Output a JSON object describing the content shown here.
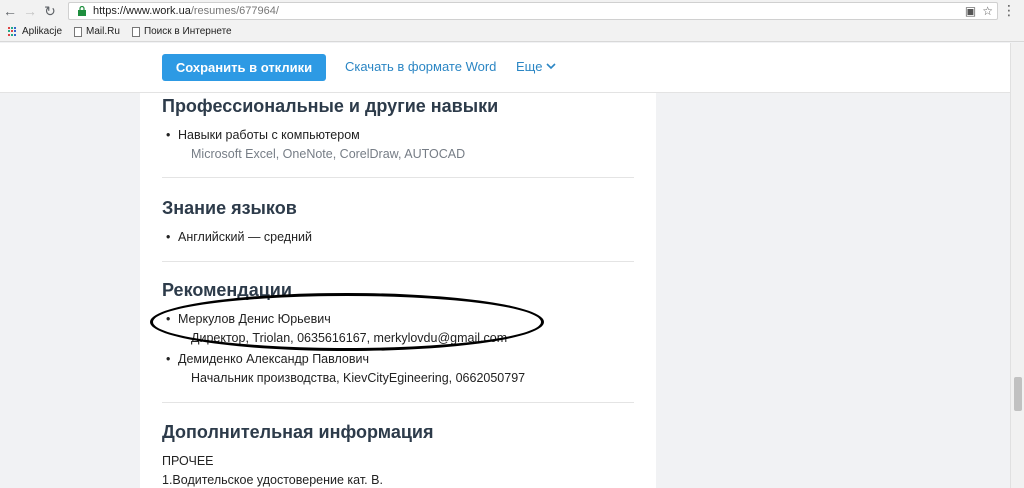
{
  "browser": {
    "url_host": "https://www.work.ua",
    "url_path": "/resumes/677964/",
    "bookmarks": [
      {
        "label": "Aplikacje",
        "icon": "apps-icon"
      },
      {
        "label": "Mail.Ru",
        "icon": "page-icon"
      },
      {
        "label": "Поиск в Интернете",
        "icon": "page-icon"
      }
    ]
  },
  "toolbar": {
    "save_label": "Сохранить в отклики",
    "word_label": "Скачать в формате Word",
    "more_label": "Еще"
  },
  "skills": {
    "title": "Профессиональные и другие навыки",
    "item": "Навыки работы с компьютером",
    "detail": "Microsoft Excel, OneNote, CorelDraw, AUTOCAD"
  },
  "languages": {
    "title": "Знание языков",
    "item": "Английский — средний"
  },
  "recommendations": {
    "title": "Рекомендации",
    "items": [
      {
        "name": "Меркулов Денис Юрьевич",
        "detail": "Директор, Triolan, 0635616167, merkylovdu@gmail.com"
      },
      {
        "name": "Демиденко Александр Павлович",
        "detail": "Начальник производства, KievCityEgineering, 0662050797"
      }
    ]
  },
  "additional": {
    "title": "Дополнительная информация",
    "line1": "ПРОЧЕЕ",
    "line2": "1.Водительское удостоверение кат. В."
  },
  "colors": {
    "accent": "#2d9ae4",
    "link": "#2b86c4",
    "heading": "#2d3b4a"
  }
}
